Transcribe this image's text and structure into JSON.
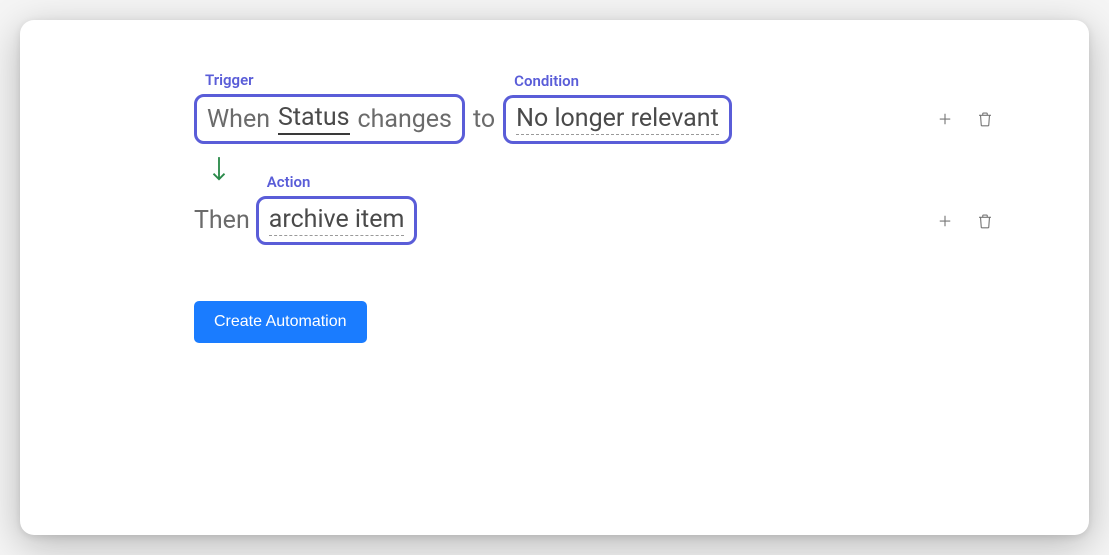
{
  "labels": {
    "trigger": "Trigger",
    "condition": "Condition",
    "action": "Action"
  },
  "trigger": {
    "prefix": "When",
    "field": "Status",
    "verb": "changes",
    "connector": "to"
  },
  "condition": {
    "value": "No longer relevant"
  },
  "action": {
    "prefix": "Then",
    "value": "archive item"
  },
  "buttons": {
    "create": "Create Automation"
  }
}
